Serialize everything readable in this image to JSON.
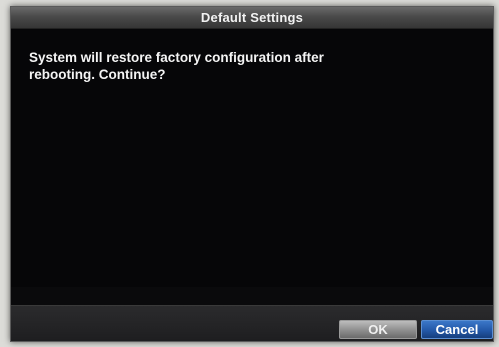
{
  "dialog": {
    "title": "Default Settings",
    "message_line1": "System will restore factory configuration after",
    "message_line2": "rebooting. Continue?"
  },
  "buttons": {
    "ok_label": "OK",
    "cancel_label": "Cancel",
    "focused": "cancel"
  },
  "colors": {
    "title_bar": "#4a4a4a",
    "dialog_background": "#0a0a0c",
    "ok_button": "#8e8e8e",
    "cancel_button_focused": "#2358a8",
    "text": "#f4f4f4"
  }
}
